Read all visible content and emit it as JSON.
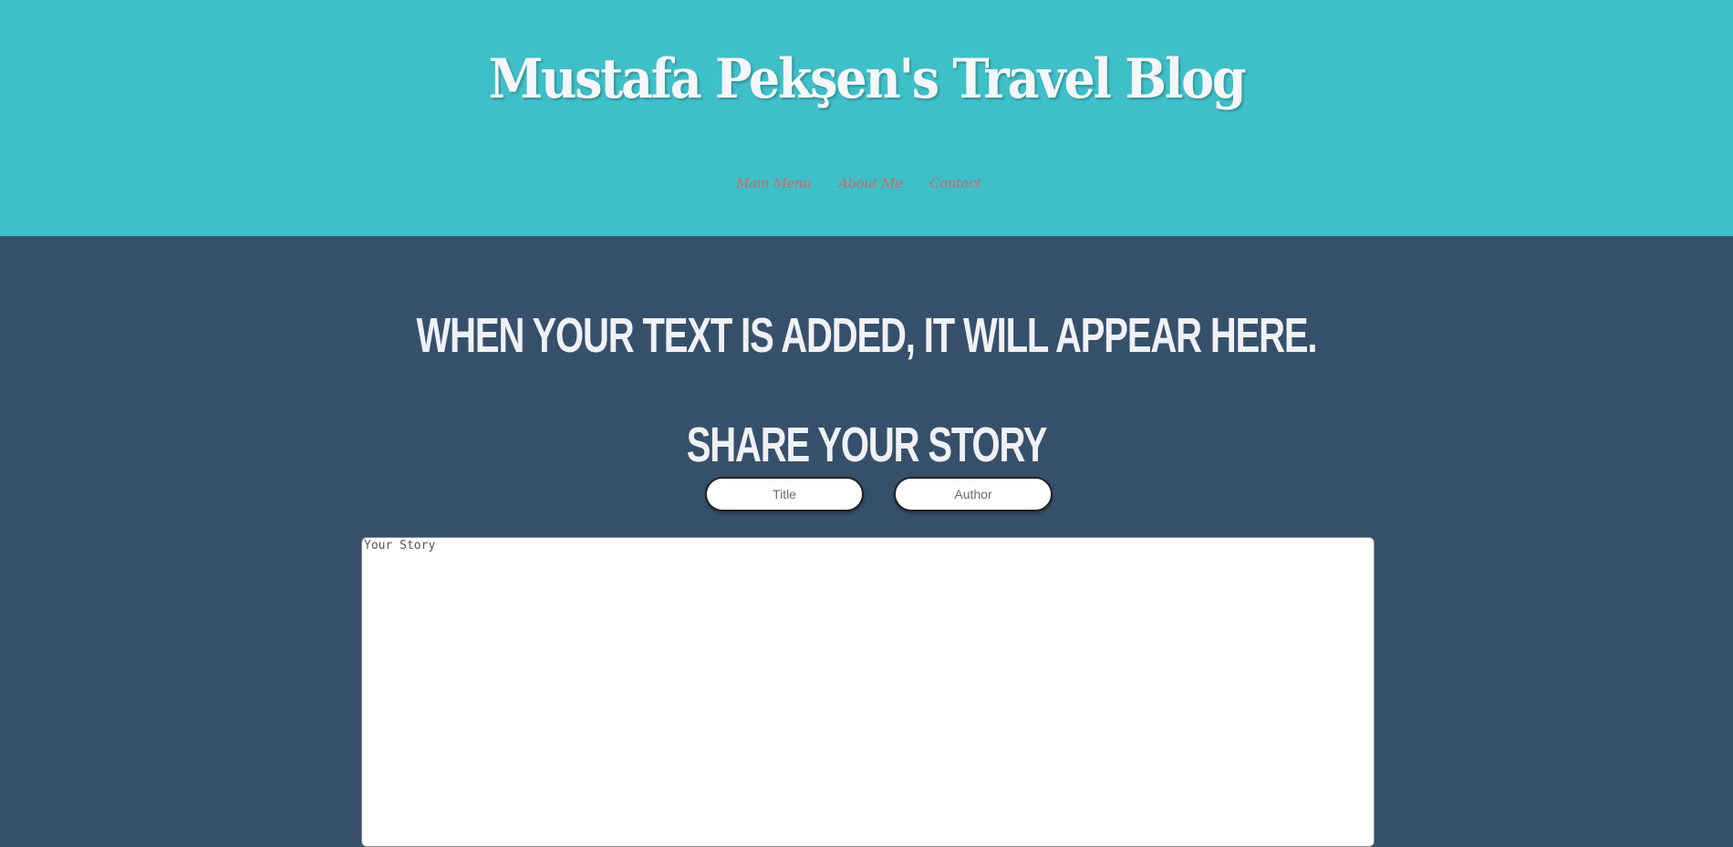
{
  "header": {
    "title": "Mustafa Pekşen's Travel Blog",
    "nav": [
      {
        "label": "Main Menu"
      },
      {
        "label": "About Me"
      },
      {
        "label": "Contact"
      }
    ]
  },
  "main": {
    "placeholder_heading": "When your text is added, it will appear here.",
    "form": {
      "heading": "Share Your Story",
      "title_placeholder": "Title",
      "author_placeholder": "Author",
      "story_placeholder": "Your Story"
    }
  },
  "colors": {
    "header_bg": "#3fc0c9",
    "body_bg": "#36506b",
    "nav_link": "#c86b6b",
    "heading_text": "#f0f1f5"
  }
}
